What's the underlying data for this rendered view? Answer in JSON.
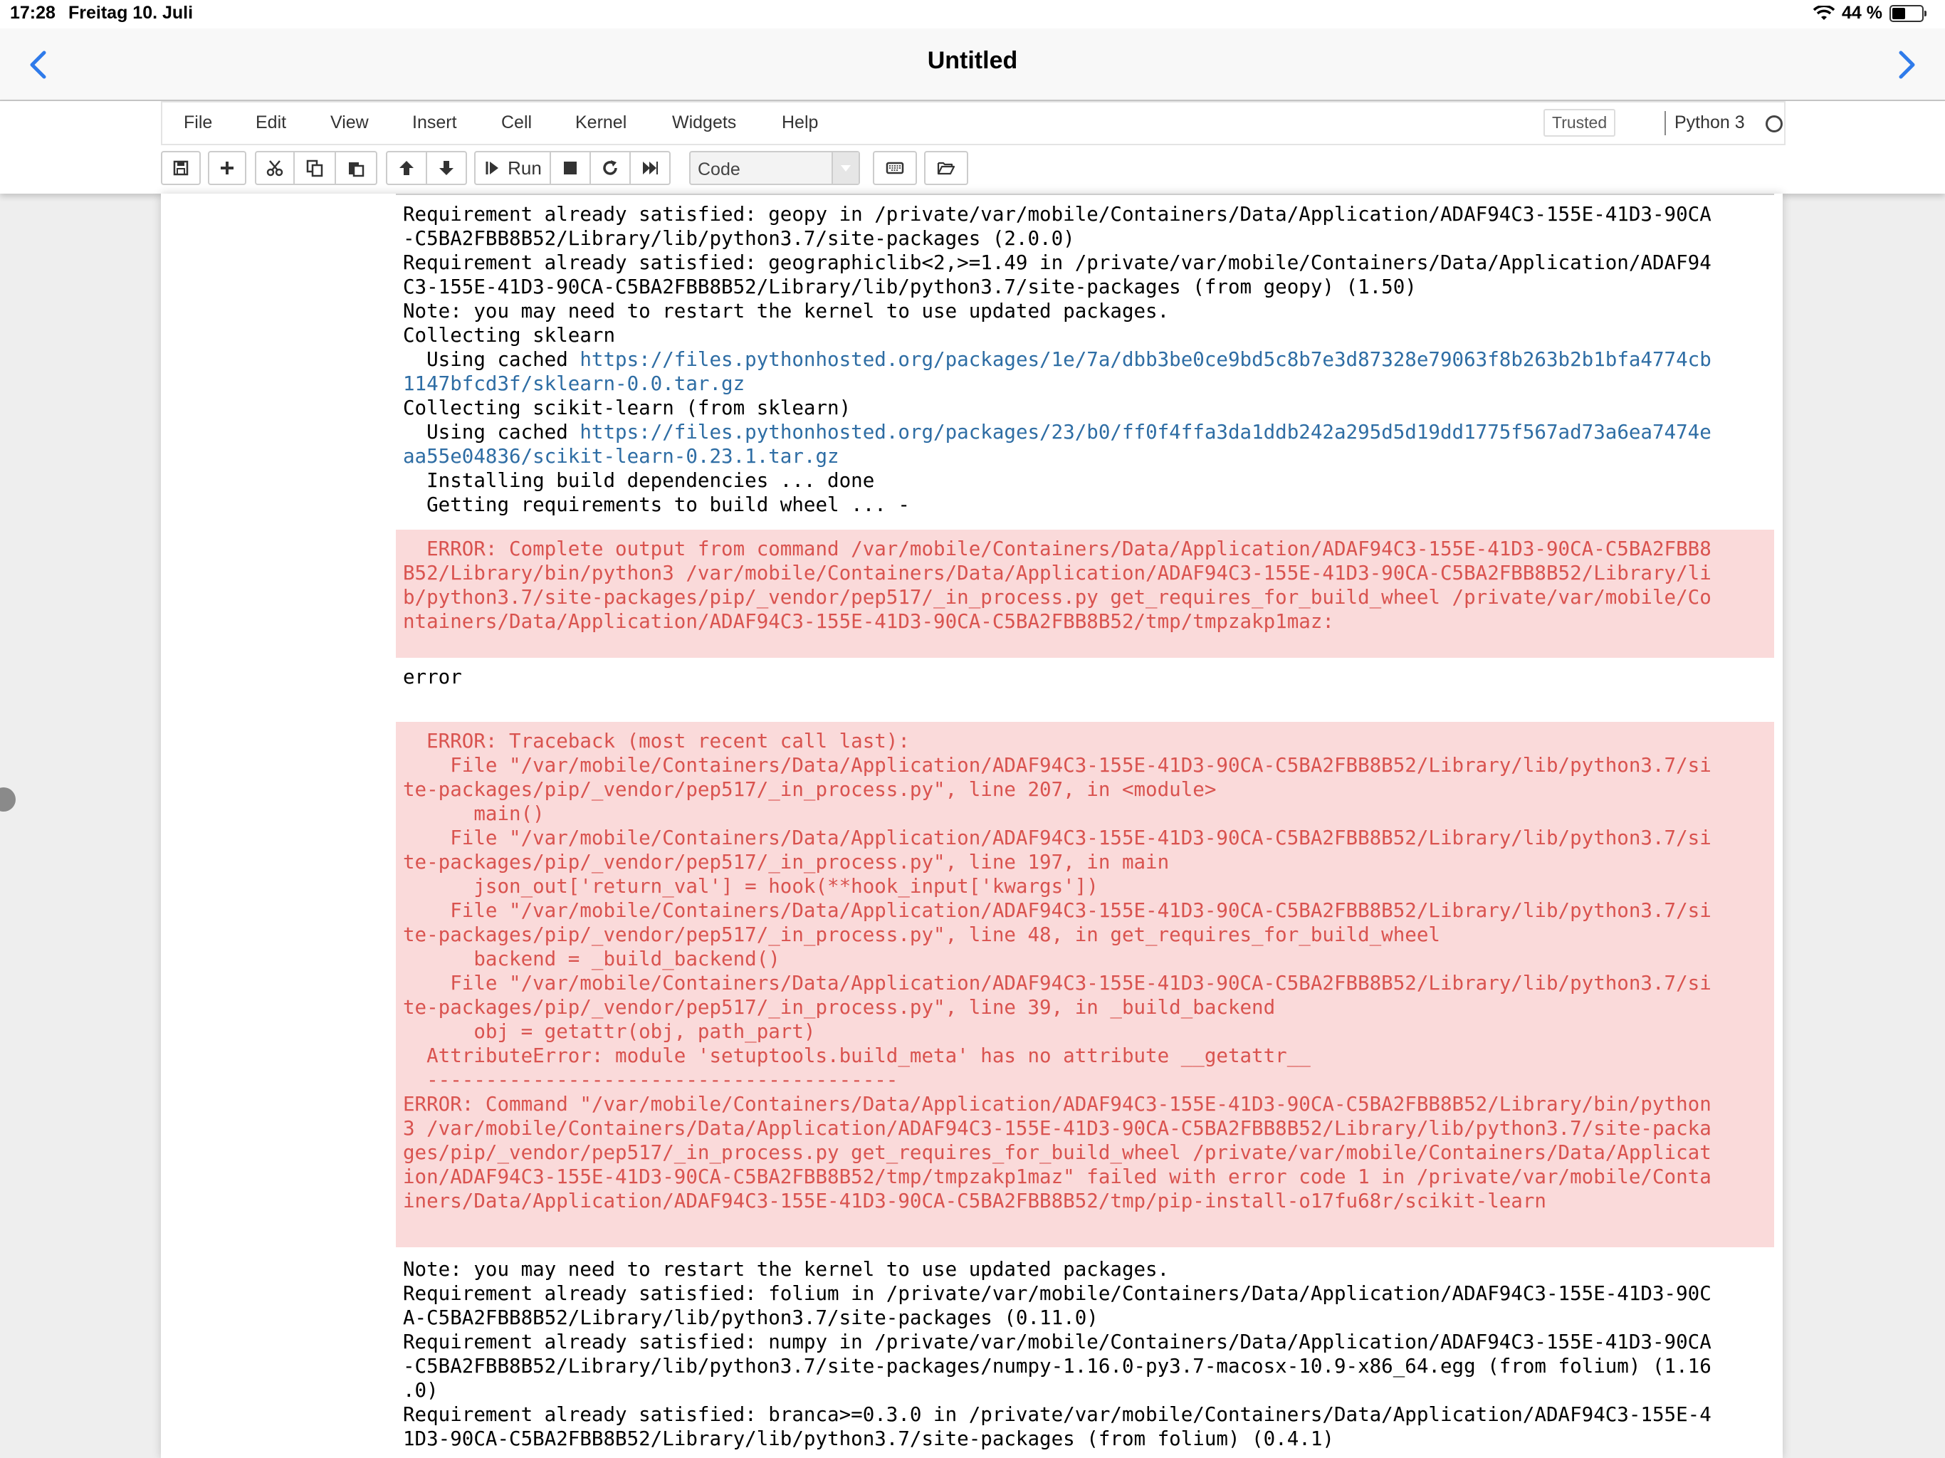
{
  "status_bar": {
    "time": "17:28",
    "date": "Freitag 10. Juli",
    "battery": "44 %",
    "battery_level": 0.44
  },
  "nav": {
    "title": "Untitled",
    "icons": [
      "chevron-left-icon",
      "chevron-right-icon"
    ],
    "accent_color": "#2f7bea"
  },
  "menu": {
    "items": [
      "File",
      "Edit",
      "View",
      "Insert",
      "Cell",
      "Kernel",
      "Widgets",
      "Help"
    ],
    "trusted": "Trusted",
    "kernel": "Python 3"
  },
  "toolbar": {
    "run_label": "Run",
    "cell_type": "Code",
    "icons": [
      "save-icon",
      "plus-icon",
      "cut-icon",
      "copy-icon",
      "paste-icon",
      "arrow-up-icon",
      "arrow-down-icon",
      "run-icon",
      "stop-icon",
      "restart-icon",
      "fast-forward-icon",
      "keyboard-icon",
      "folder-open-icon"
    ]
  },
  "output": {
    "block1": {
      "l1": "Requirement already satisfied: geopy in /private/var/mobile/Containers/Data/Application/ADAF94C3-155E-41D3-90CA",
      "l2": "-C5BA2FBB8B52/Library/lib/python3.7/site-packages (2.0.0)",
      "l3": "Requirement already satisfied: geographiclib<2,>=1.49 in /private/var/mobile/Containers/Data/Application/ADAF94",
      "l4": "C3-155E-41D3-90CA-C5BA2FBB8B52/Library/lib/python3.7/site-packages (from geopy) (1.50)",
      "l5": "Note: you may need to restart the kernel to use updated packages.",
      "l6": "Collecting sklearn",
      "l7_prefix": "  Using cached ",
      "l7_link": "https://files.pythonhosted.org/packages/1e/7a/dbb3be0ce9bd5c8b7e3d87328e79063f8b263b2b1bfa4774cb",
      "l8_link": "1147bfcd3f/sklearn-0.0.tar.gz",
      "l9": "Collecting scikit-learn (from sklearn)",
      "l10_prefix": "  Using cached ",
      "l10_link": "https://files.pythonhosted.org/packages/23/b0/ff0f4ffa3da1ddb242a295d5d19dd1775f567ad73a6ea7474e",
      "l11_link": "aa55e04836/scikit-learn-0.23.1.tar.gz",
      "l12": "  Installing build dependencies ... done",
      "l13": "  Getting requirements to build wheel ... -"
    },
    "error1": {
      "l1": "  ERROR: Complete output from command /var/mobile/Containers/Data/Application/ADAF94C3-155E-41D3-90CA-C5BA2FBB8",
      "l2": "B52/Library/bin/python3 /var/mobile/Containers/Data/Application/ADAF94C3-155E-41D3-90CA-C5BA2FBB8B52/Library/li",
      "l3": "b/python3.7/site-packages/pip/_vendor/pep517/_in_process.py get_requires_for_build_wheel /private/var/mobile/Co",
      "l4": "ntainers/Data/Application/ADAF94C3-155E-41D3-90CA-C5BA2FBB8B52/tmp/tmpzakp1maz:"
    },
    "plain_error": "error",
    "error2": {
      "l1": "  ERROR: Traceback (most recent call last):",
      "l2": "    File \"/var/mobile/Containers/Data/Application/ADAF94C3-155E-41D3-90CA-C5BA2FBB8B52/Library/lib/python3.7/si",
      "l3": "te-packages/pip/_vendor/pep517/_in_process.py\", line 207, in <module>",
      "l4": "      main()",
      "l5": "    File \"/var/mobile/Containers/Data/Application/ADAF94C3-155E-41D3-90CA-C5BA2FBB8B52/Library/lib/python3.7/si",
      "l6": "te-packages/pip/_vendor/pep517/_in_process.py\", line 197, in main",
      "l7": "      json_out['return_val'] = hook(**hook_input['kwargs'])",
      "l8": "    File \"/var/mobile/Containers/Data/Application/ADAF94C3-155E-41D3-90CA-C5BA2FBB8B52/Library/lib/python3.7/si",
      "l9": "te-packages/pip/_vendor/pep517/_in_process.py\", line 48, in get_requires_for_build_wheel",
      "l10": "      backend = _build_backend()",
      "l11": "    File \"/var/mobile/Containers/Data/Application/ADAF94C3-155E-41D3-90CA-C5BA2FBB8B52/Library/lib/python3.7/si",
      "l12": "te-packages/pip/_vendor/pep517/_in_process.py\", line 39, in _build_backend",
      "l13": "      obj = getattr(obj, path_part)",
      "l14": "  AttributeError: module 'setuptools.build_meta' has no attribute __getattr__",
      "l15": "  ----------------------------------------",
      "l16": "ERROR: Command \"/var/mobile/Containers/Data/Application/ADAF94C3-155E-41D3-90CA-C5BA2FBB8B52/Library/bin/python",
      "l17": "3 /var/mobile/Containers/Data/Application/ADAF94C3-155E-41D3-90CA-C5BA2FBB8B52/Library/lib/python3.7/site-packa",
      "l18": "ges/pip/_vendor/pep517/_in_process.py get_requires_for_build_wheel /private/var/mobile/Containers/Data/Applicat",
      "l19": "ion/ADAF94C3-155E-41D3-90CA-C5BA2FBB8B52/tmp/tmpzakp1maz\" failed with error code 1 in /private/var/mobile/Conta",
      "l20": "iners/Data/Application/ADAF94C3-155E-41D3-90CA-C5BA2FBB8B52/tmp/pip-install-o17fu68r/scikit-learn"
    },
    "block2": {
      "l1": "Note: you may need to restart the kernel to use updated packages.",
      "l2": "Requirement already satisfied: folium in /private/var/mobile/Containers/Data/Application/ADAF94C3-155E-41D3-90C",
      "l3": "A-C5BA2FBB8B52/Library/lib/python3.7/site-packages (0.11.0)",
      "l4": "Requirement already satisfied: numpy in /private/var/mobile/Containers/Data/Application/ADAF94C3-155E-41D3-90CA",
      "l5": "-C5BA2FBB8B52/Library/lib/python3.7/site-packages/numpy-1.16.0-py3.7-macosx-10.9-x86_64.egg (from folium) (1.16",
      "l6": ".0)",
      "l7": "Requirement already satisfied: branca>=0.3.0 in /private/var/mobile/Containers/Data/Application/ADAF94C3-155E-4",
      "l8": "1D3-90CA-C5BA2FBB8B52/Library/lib/python3.7/site-packages (from folium) (0.4.1)"
    }
  }
}
